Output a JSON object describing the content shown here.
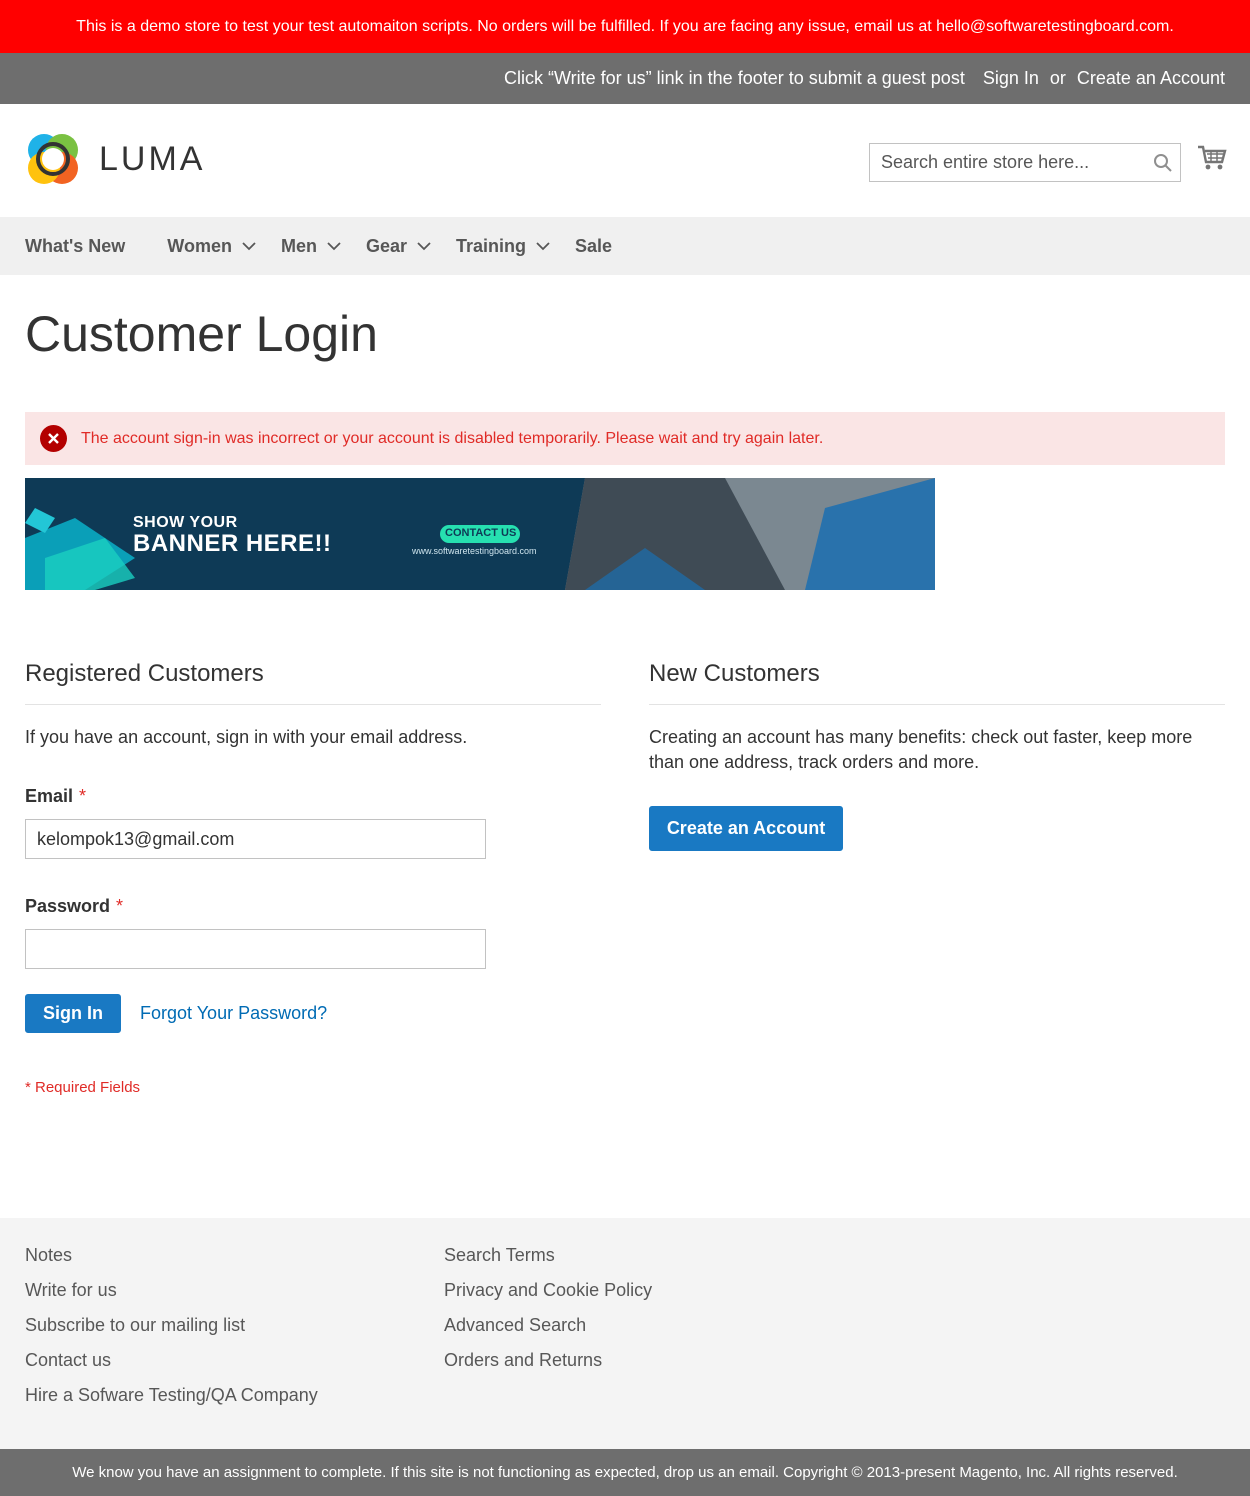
{
  "demo_notice": "This is a demo store to test your test automaiton scripts. No orders will be fulfilled. If you are facing any issue, email us at hello@softwaretestingboard.com.",
  "top_bar": {
    "promo": "Click “Write for us” link in the footer to submit a guest post",
    "sign_in": "Sign In",
    "or": "or",
    "create_account": "Create an Account"
  },
  "header": {
    "logo_text": "LUMA",
    "search_placeholder": "Search entire store here..."
  },
  "nav": {
    "items": [
      {
        "label": "What's New"
      },
      {
        "label": "Women"
      },
      {
        "label": "Men"
      },
      {
        "label": "Gear"
      },
      {
        "label": "Training"
      },
      {
        "label": "Sale"
      }
    ]
  },
  "page_title": "Customer Login",
  "error_message": "The account sign-in was incorrect or your account is disabled temporarily. Please wait and try again later.",
  "banner": {
    "line1": "SHOW YOUR",
    "line2": "BANNER HERE!!",
    "cta": "CONTACT US",
    "url": "www.softwaretestingboard.com"
  },
  "registered": {
    "title": "Registered Customers",
    "intro": "If you have an account, sign in with your email address.",
    "email_label": "Email",
    "email_value": "kelompok13@gmail.com",
    "password_label": "Password",
    "required_mark": "*",
    "sign_in": "Sign In",
    "forgot": "Forgot Your Password?",
    "required_note": "* Required Fields"
  },
  "new_customers": {
    "title": "New Customers",
    "intro": "Creating an account has many benefits: check out faster, keep more than one address, track orders and more.",
    "create_account": "Create an Account"
  },
  "footer": {
    "col1": [
      "Notes",
      "Write for us",
      "Subscribe to our mailing list",
      "Contact us",
      "Hire a Sofware Testing/QA Company"
    ],
    "col2": [
      "Search Terms",
      "Privacy and Cookie Policy",
      "Advanced Search",
      "Orders and Returns"
    ]
  },
  "copyright": "We know you have an assignment to complete. If this site is not functioning as expected, drop us an email. Copyright © 2013-present Magento, Inc. All rights reserved."
}
